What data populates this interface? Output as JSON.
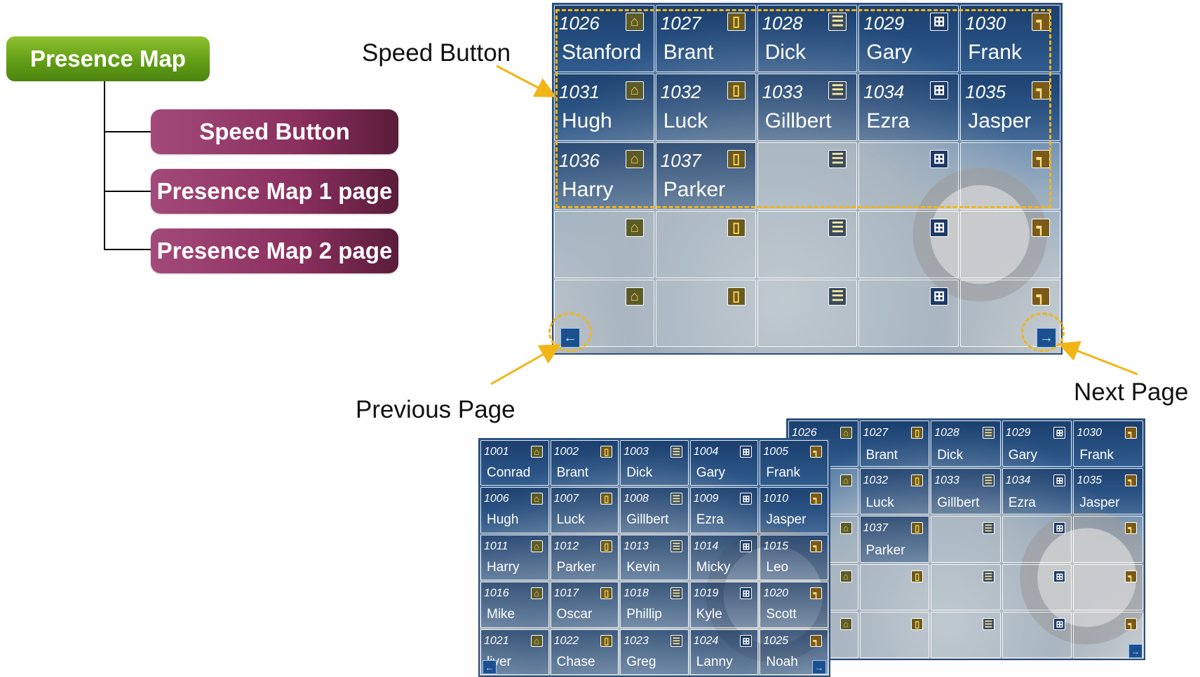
{
  "tree": {
    "root": "Presence Map",
    "children": [
      "Speed Button",
      "Presence Map 1 page",
      "Presence Map 2 page"
    ]
  },
  "annotations": {
    "speed_button": "Speed Button",
    "previous_page": "Previous Page",
    "next_page": "Next Page"
  },
  "icons": [
    "home-icon",
    "phone-icon",
    "office-icon",
    "window-icon",
    "stairs-icon"
  ],
  "colors": {
    "callout": "#f2b516",
    "root_node": "#6aa61a",
    "child_node": "#8a2f5e",
    "panel": "#2c5a8f"
  },
  "panel_page2": {
    "cells": [
      {
        "ext": "1026",
        "name": "Stanford"
      },
      {
        "ext": "1027",
        "name": "Brant"
      },
      {
        "ext": "1028",
        "name": "Dick"
      },
      {
        "ext": "1029",
        "name": "Gary"
      },
      {
        "ext": "1030",
        "name": "Frank"
      },
      {
        "ext": "1031",
        "name": "Hugh"
      },
      {
        "ext": "1032",
        "name": "Luck"
      },
      {
        "ext": "1033",
        "name": "Gillbert"
      },
      {
        "ext": "1034",
        "name": "Ezra"
      },
      {
        "ext": "1035",
        "name": "Jasper"
      },
      {
        "ext": "1036",
        "name": "Harry"
      },
      {
        "ext": "1037",
        "name": "Parker"
      },
      {
        "ext": "",
        "name": ""
      },
      {
        "ext": "",
        "name": ""
      },
      {
        "ext": "",
        "name": ""
      },
      {
        "ext": "",
        "name": ""
      },
      {
        "ext": "",
        "name": ""
      },
      {
        "ext": "",
        "name": ""
      },
      {
        "ext": "",
        "name": ""
      },
      {
        "ext": "",
        "name": ""
      },
      {
        "ext": "",
        "name": ""
      },
      {
        "ext": "",
        "name": ""
      },
      {
        "ext": "",
        "name": ""
      },
      {
        "ext": "",
        "name": ""
      },
      {
        "ext": "",
        "name": ""
      }
    ]
  },
  "panel_back": {
    "cells": [
      {
        "ext": "1026",
        "name": "rd"
      },
      {
        "ext": "1027",
        "name": "Brant"
      },
      {
        "ext": "1028",
        "name": "Dick"
      },
      {
        "ext": "1029",
        "name": "Gary"
      },
      {
        "ext": "1030",
        "name": "Frank"
      },
      {
        "ext": "",
        "name": ""
      },
      {
        "ext": "1032",
        "name": "Luck"
      },
      {
        "ext": "1033",
        "name": "Gillbert"
      },
      {
        "ext": "1034",
        "name": "Ezra"
      },
      {
        "ext": "1035",
        "name": "Jasper"
      },
      {
        "ext": "",
        "name": ""
      },
      {
        "ext": "1037",
        "name": "Parker"
      },
      {
        "ext": "",
        "name": ""
      },
      {
        "ext": "",
        "name": ""
      },
      {
        "ext": "",
        "name": ""
      },
      {
        "ext": "",
        "name": ""
      },
      {
        "ext": "",
        "name": ""
      },
      {
        "ext": "",
        "name": ""
      },
      {
        "ext": "",
        "name": ""
      },
      {
        "ext": "",
        "name": ""
      },
      {
        "ext": "",
        "name": ""
      },
      {
        "ext": "",
        "name": ""
      },
      {
        "ext": "",
        "name": ""
      },
      {
        "ext": "",
        "name": ""
      },
      {
        "ext": "",
        "name": ""
      }
    ]
  },
  "panel_page1": {
    "cells": [
      {
        "ext": "1001",
        "name": "Conrad"
      },
      {
        "ext": "1002",
        "name": "Brant"
      },
      {
        "ext": "1003",
        "name": "Dick"
      },
      {
        "ext": "1004",
        "name": "Gary"
      },
      {
        "ext": "1005",
        "name": "Frank"
      },
      {
        "ext": "1006",
        "name": "Hugh"
      },
      {
        "ext": "1007",
        "name": "Luck"
      },
      {
        "ext": "1008",
        "name": "Gillbert"
      },
      {
        "ext": "1009",
        "name": "Ezra"
      },
      {
        "ext": "1010",
        "name": "Jasper"
      },
      {
        "ext": "1011",
        "name": "Harry"
      },
      {
        "ext": "1012",
        "name": "Parker"
      },
      {
        "ext": "1013",
        "name": "Kevin"
      },
      {
        "ext": "1014",
        "name": "Micky"
      },
      {
        "ext": "1015",
        "name": "Leo"
      },
      {
        "ext": "1016",
        "name": "Mike"
      },
      {
        "ext": "1017",
        "name": "Oscar"
      },
      {
        "ext": "1018",
        "name": "Phillip"
      },
      {
        "ext": "1019",
        "name": "Kyle"
      },
      {
        "ext": "1020",
        "name": "Scott"
      },
      {
        "ext": "1021",
        "name": "liver"
      },
      {
        "ext": "1022",
        "name": "Chase"
      },
      {
        "ext": "1023",
        "name": "Greg"
      },
      {
        "ext": "1024",
        "name": "Lanny"
      },
      {
        "ext": "1025",
        "name": "Noah"
      }
    ]
  }
}
